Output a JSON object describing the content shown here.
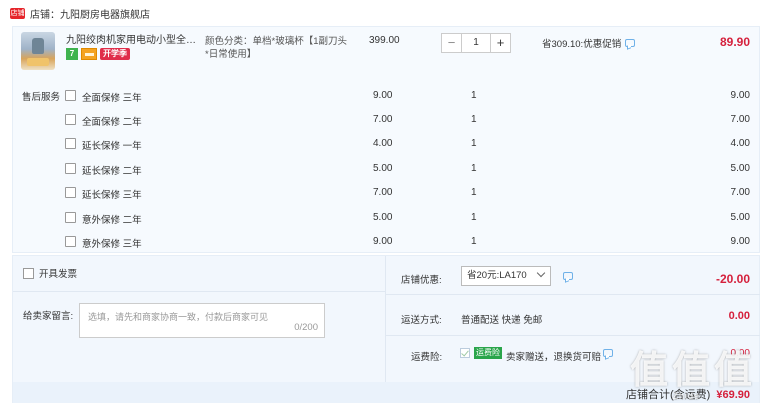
{
  "shop": {
    "icon": "shop-badge-icon",
    "badge": "店铺",
    "label": "店铺：九阳厨房电器旗舰店"
  },
  "item": {
    "title": "九阳绞肉机家用电动小型全自动...",
    "tag_seven": "7",
    "tag_promo": "开学季",
    "sku": "颜色分类：单档*玻璃杯【1副刀头*日常使用】",
    "unit_price": "399.00",
    "quantity": "1",
    "qty_minus": "−",
    "qty_plus": "+",
    "discount": "省309.10:优惠促销",
    "total": "89.90"
  },
  "services": {
    "label": "售后服务",
    "rows": [
      {
        "name": "全面保修 三年",
        "price": "9.00",
        "qty": "1",
        "total": "9.00"
      },
      {
        "name": "全面保修 二年",
        "price": "7.00",
        "qty": "1",
        "total": "7.00"
      },
      {
        "name": "延长保修 一年",
        "price": "4.00",
        "qty": "1",
        "total": "4.00"
      },
      {
        "name": "延长保修 二年",
        "price": "5.00",
        "qty": "1",
        "total": "5.00"
      },
      {
        "name": "延长保修 三年",
        "price": "7.00",
        "qty": "1",
        "total": "7.00"
      },
      {
        "name": "意外保修 二年",
        "price": "5.00",
        "qty": "1",
        "total": "5.00"
      },
      {
        "name": "意外保修 三年",
        "price": "9.00",
        "qty": "1",
        "total": "9.00"
      }
    ]
  },
  "invoice": {
    "label": "开具发票"
  },
  "message": {
    "label": "给卖家留言:",
    "placeholder": "选填，请先和商家协商一致，付款后商家可见",
    "count": "0/200"
  },
  "coupon": {
    "label": "店铺优惠:",
    "selected": "省20元:LA170",
    "amount": "-20.00"
  },
  "shipping": {
    "label": "运送方式:",
    "value": "普通配送 快递 免邮",
    "amount": "0.00"
  },
  "insurance": {
    "label": "运费险:",
    "badge": "运费险",
    "text": "卖家赠送，退换货可赔",
    "amount": "0.00"
  },
  "summary": {
    "label": "店铺合计(含运费)",
    "value": "¥69.90"
  },
  "watermark": {
    "glyphs": [
      "值",
      "值",
      "值"
    ],
    "sub": "Zhide"
  },
  "colors": {
    "accent_red": "#d5203c",
    "panel_bg": "#f6fafe",
    "shop_badge": "#e5252b"
  }
}
